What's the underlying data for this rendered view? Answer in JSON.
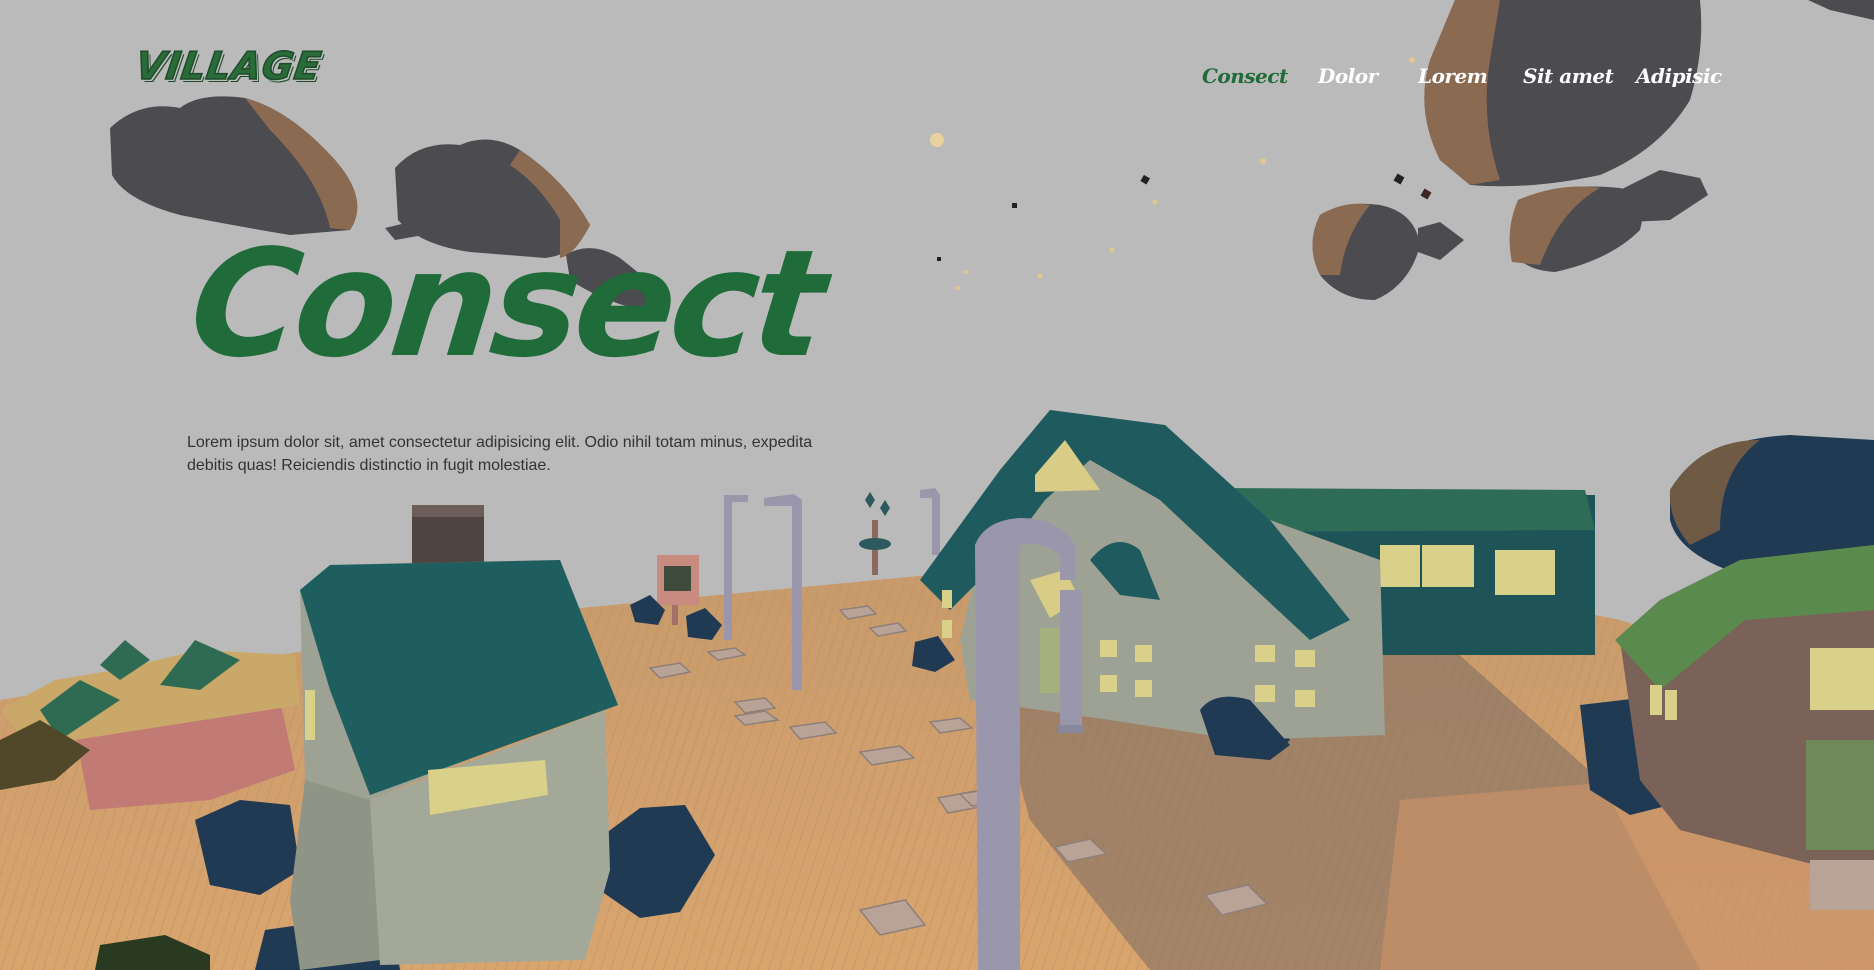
{
  "brand": {
    "logo_text": "VILLAGE"
  },
  "nav": {
    "items": [
      {
        "label": "Consect",
        "active": true
      },
      {
        "label": "Dolor",
        "active": false
      },
      {
        "label": "Lorem",
        "active": false
      },
      {
        "label": "Sit amet",
        "active": false
      },
      {
        "label": "Adipisic",
        "active": false
      }
    ]
  },
  "hero": {
    "title": "Consect",
    "description": "Lorem ipsum dolor sit, amet consectetur adipisicing elit. Odio nihil totam minus, expedita debitis quas! Reiciendis distinctio in fugit molestiae."
  },
  "colors": {
    "sky": "#bababa",
    "accent_green": "#1f6b3a",
    "nav_text": "#ffffff",
    "body_text": "#333333",
    "ground": "#d4a06d",
    "roof_teal": "#1e5a5e",
    "cloud": "#4a4a4e"
  }
}
